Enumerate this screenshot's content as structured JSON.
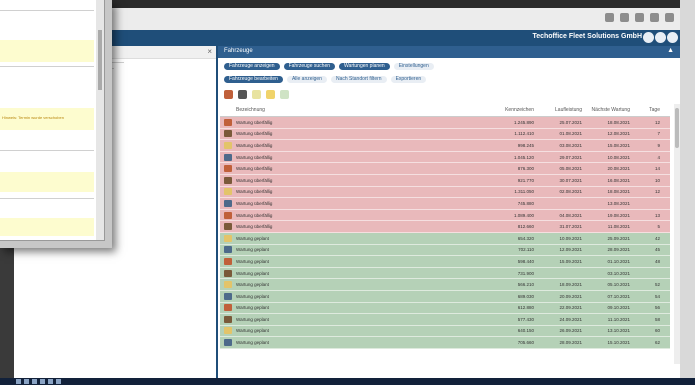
{
  "app": {
    "title": "Techoffice Fleet Solutions GmbH",
    "colors": {
      "header": "#1f4e79",
      "red_row": "#e9b9bb",
      "green_row": "#b5d1b7",
      "accent": "#2f5f8f"
    }
  },
  "tab": {
    "label": "Fahrzeuge"
  },
  "filter_chips_row1": [
    {
      "label": "Fahrzeuge anzeigen",
      "active": true
    },
    {
      "label": "Fahrzeuge suchen",
      "active": true
    },
    {
      "label": "Wartungen planen",
      "active": true
    },
    {
      "label": "Einstellungen",
      "active": false
    }
  ],
  "filter_chips_row2": [
    {
      "label": "Fahrzeuge bearbeiten",
      "active": true
    },
    {
      "label": "Alle anzeigen",
      "active": false
    },
    {
      "label": "Nach Standort filtern",
      "active": false
    },
    {
      "label": "Exportieren",
      "active": false
    }
  ],
  "grid": {
    "columns": [
      "Bezeichnung",
      "Kennzeichen",
      "Laufleistung",
      "Nächste Wartung",
      "Tage"
    ],
    "rows": [
      {
        "status": "red",
        "name": "Wartung überfällig",
        "c1": "1.245.890",
        "c2": "25.07.2021",
        "c3": "18.08.2021",
        "c4": "12"
      },
      {
        "status": "red",
        "name": "Wartung überfällig",
        "c1": "1.112.410",
        "c2": "01.08.2021",
        "c3": "12.08.2021",
        "c4": "7"
      },
      {
        "status": "red",
        "name": "Wartung überfällig",
        "c1": "998.245",
        "c2": "03.08.2021",
        "c3": "15.08.2021",
        "c4": "9"
      },
      {
        "status": "red",
        "name": "Wartung überfällig",
        "c1": "1.045.120",
        "c2": "29.07.2021",
        "c3": "10.08.2021",
        "c4": "4"
      },
      {
        "status": "red",
        "name": "Wartung überfällig",
        "c1": "876.300",
        "c2": "05.08.2021",
        "c3": "20.08.2021",
        "c4": "14"
      },
      {
        "status": "red",
        "name": "Wartung überfällig",
        "c1": "921.770",
        "c2": "30.07.2021",
        "c3": "16.08.2021",
        "c4": "10"
      },
      {
        "status": "red",
        "name": "Wartung überfällig",
        "c1": "1.311.050",
        "c2": "02.08.2021",
        "c3": "18.08.2021",
        "c4": "12"
      },
      {
        "status": "red",
        "name": "Wartung überfällig",
        "c1": "745.880",
        "c2": "",
        "c3": "13.08.2021",
        "c4": ""
      },
      {
        "status": "red",
        "name": "Wartung überfällig",
        "c1": "1.089.400",
        "c2": "04.08.2021",
        "c3": "19.08.2021",
        "c4": "13"
      },
      {
        "status": "red",
        "name": "Wartung überfällig",
        "c1": "812.660",
        "c2": "31.07.2021",
        "c3": "11.08.2021",
        "c4": "5"
      },
      {
        "status": "green",
        "name": "Wartung geplant",
        "c1": "654.320",
        "c2": "10.09.2021",
        "c3": "25.09.2021",
        "c4": "42"
      },
      {
        "status": "green",
        "name": "Wartung geplant",
        "c1": "702.110",
        "c2": "12.09.2021",
        "c3": "28.09.2021",
        "c4": "45"
      },
      {
        "status": "green",
        "name": "Wartung geplant",
        "c1": "598.440",
        "c2": "15.09.2021",
        "c3": "01.10.2021",
        "c4": "48"
      },
      {
        "status": "green",
        "name": "Wartung geplant",
        "c1": "731.900",
        "c2": "",
        "c3": "03.10.2021",
        "c4": ""
      },
      {
        "status": "green",
        "name": "Wartung geplant",
        "c1": "566.210",
        "c2": "18.09.2021",
        "c3": "05.10.2021",
        "c4": "52"
      },
      {
        "status": "green",
        "name": "Wartung geplant",
        "c1": "689.030",
        "c2": "20.09.2021",
        "c3": "07.10.2021",
        "c4": "54"
      },
      {
        "status": "green",
        "name": "Wartung geplant",
        "c1": "612.880",
        "c2": "22.09.2021",
        "c3": "09.10.2021",
        "c4": "56"
      },
      {
        "status": "green",
        "name": "Wartung geplant",
        "c1": "577.430",
        "c2": "24.09.2021",
        "c3": "11.10.2021",
        "c4": "58"
      },
      {
        "status": "green",
        "name": "Wartung geplant",
        "c1": "640.150",
        "c2": "26.09.2021",
        "c3": "13.10.2021",
        "c4": "60"
      },
      {
        "status": "green",
        "name": "Wartung geplant",
        "c1": "705.660",
        "c2": "28.09.2021",
        "c3": "15.10.2021",
        "c4": "62"
      }
    ]
  },
  "overlay": {
    "note_text": "Hinweis: Termin wurde verschoben"
  }
}
